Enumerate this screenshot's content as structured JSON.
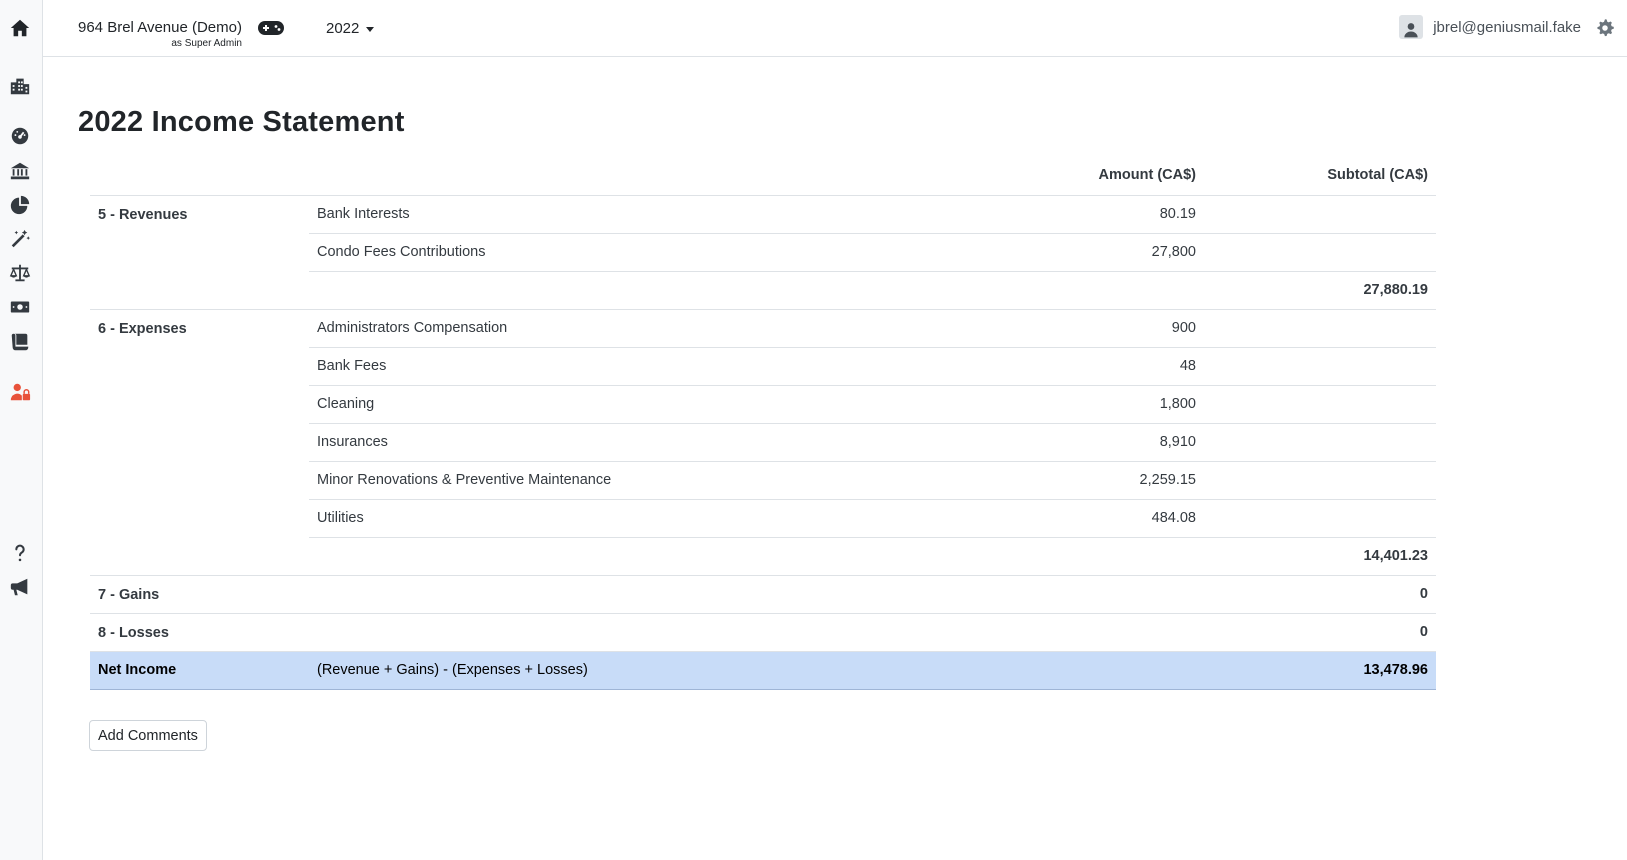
{
  "header": {
    "org_name": "964 Brel Avenue (Demo)",
    "org_role": "as Super Admin",
    "year": "2022",
    "user_email": "jbrel@geniusmail.fake"
  },
  "sidebar": {
    "items": [
      {
        "icon": "home-icon"
      },
      {
        "icon": "buildings-icon"
      },
      {
        "icon": "dashboard-icon"
      },
      {
        "icon": "bank-icon"
      },
      {
        "icon": "pie-chart-icon"
      },
      {
        "icon": "magic-wand-icon"
      },
      {
        "icon": "balance-scale-icon"
      },
      {
        "icon": "money-bill-icon"
      },
      {
        "icon": "receipt-icon"
      },
      {
        "icon": "user-lock-icon",
        "color": "#e8523a"
      },
      {
        "icon": "help-icon"
      },
      {
        "icon": "announcement-icon"
      }
    ]
  },
  "page": {
    "title": "2022 Income Statement"
  },
  "table": {
    "headers": {
      "amount": "Amount (CA$)",
      "subtotal": "Subtotal (CA$)"
    },
    "revenues": {
      "label": "5 - Revenues",
      "rows": [
        {
          "desc": "Bank Interests",
          "amount": "80.19"
        },
        {
          "desc": "Condo Fees Contributions",
          "amount": "27,800"
        }
      ],
      "subtotal": "27,880.19"
    },
    "expenses": {
      "label": "6 - Expenses",
      "rows": [
        {
          "desc": "Administrators Compensation",
          "amount": "900"
        },
        {
          "desc": "Bank Fees",
          "amount": "48"
        },
        {
          "desc": "Cleaning",
          "amount": "1,800"
        },
        {
          "desc": "Insurances",
          "amount": "8,910"
        },
        {
          "desc": "Minor Renovations & Preventive Maintenance",
          "amount": "2,259.15"
        },
        {
          "desc": "Utilities",
          "amount": "484.08"
        }
      ],
      "subtotal": "14,401.23"
    },
    "gains": {
      "label": "7 - Gains",
      "subtotal": "0"
    },
    "losses": {
      "label": "8 - Losses",
      "subtotal": "0"
    },
    "net_income": {
      "label": "Net Income",
      "formula": "(Revenue + Gains) - (Expenses + Losses)",
      "value": "13,478.96"
    }
  },
  "actions": {
    "add_comments": "Add Comments"
  },
  "colors": {
    "accent": "#e8523a",
    "net_income_bg": "#c8dcf8",
    "icon": "#343a40"
  }
}
